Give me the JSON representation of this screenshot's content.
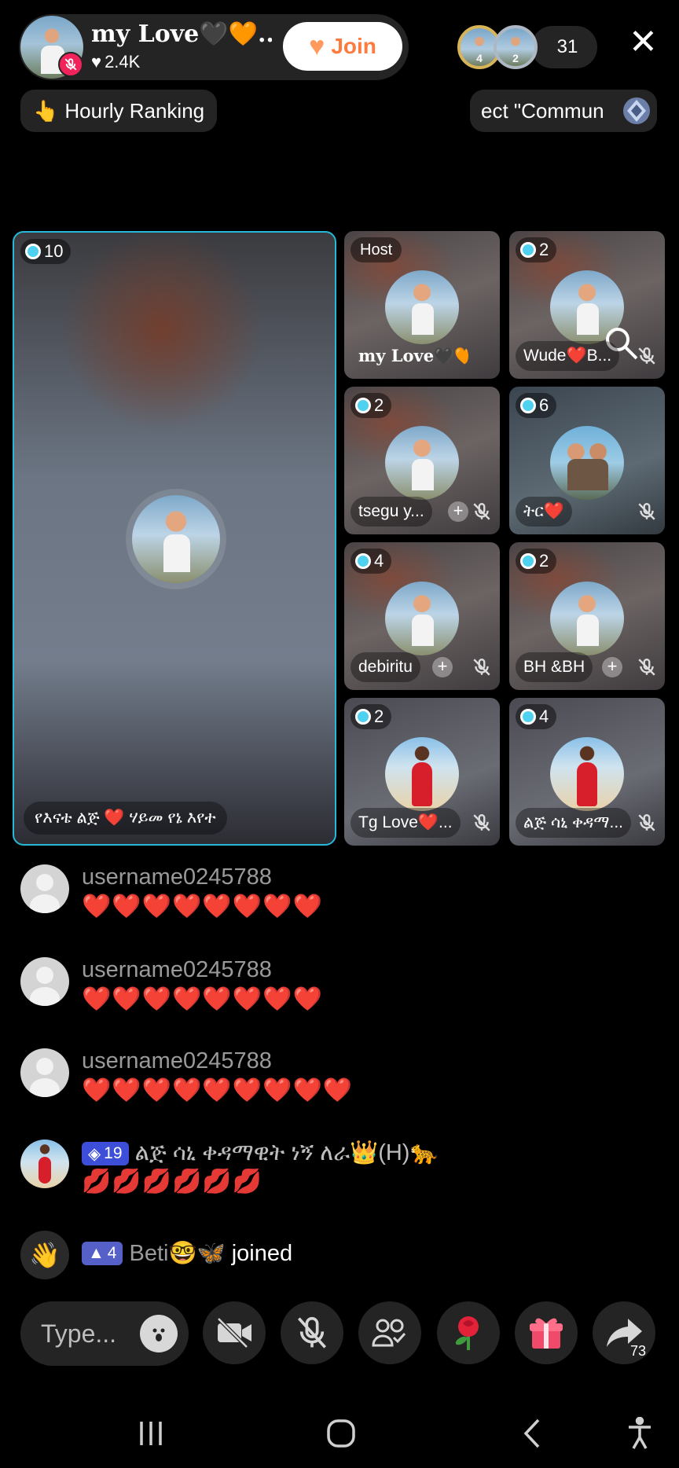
{
  "host": {
    "name": "my Love🖤🧡...",
    "likes": "2.4K",
    "join_label": "Join"
  },
  "viewers": {
    "top1_rank": "4",
    "top2_rank": "2",
    "count": "31"
  },
  "chips": {
    "hourly_ranking": "Hourly Ranking",
    "community": "ect \"Commun"
  },
  "main_seat": {
    "level": "10",
    "name": "የእናቴ ልጅ ❤️ ሃይመ የኔ እየተ"
  },
  "seats": [
    {
      "tag": "Host",
      "name": "my Love🖤🧡❤️"
    },
    {
      "level": "2",
      "name": "Wude❤️B..."
    },
    {
      "level": "2",
      "name": "tsegu  y..."
    },
    {
      "level": "6",
      "name": "ትር❤️"
    },
    {
      "level": "4",
      "name": "debiritu"
    },
    {
      "level": "2",
      "name": "BH  &BH"
    },
    {
      "level": "2",
      "name": "Tg Love❤️..."
    },
    {
      "level": "4",
      "name": "ልጅ ሳኒ ቀዳማ..."
    }
  ],
  "chat": [
    {
      "user": "username0245788",
      "message": "❤️❤️❤️❤️❤️❤️❤️❤️"
    },
    {
      "user": "username0245788",
      "message": "❤️❤️❤️❤️❤️❤️❤️❤️"
    },
    {
      "user": "username0245788",
      "message": "❤️❤️❤️❤️❤️❤️❤️❤️❤️"
    },
    {
      "level": "19",
      "user": "ልጅ ሳኒ ቀዳማዊት ነኝ ለራ👑(H)🐆",
      "message": "💋💋💋💋💋💋"
    },
    {
      "level": "4",
      "user": "Beti🤓🦋",
      "action": "joined"
    }
  ],
  "bottom": {
    "input_placeholder": "Type...",
    "share_count": "73"
  },
  "colors": {
    "accent_join": "#ff7a3d",
    "active_seat_border": "#25b8d8",
    "level_badge": "#3d4fd8",
    "pill_bg": "#242424"
  },
  "icons": [
    "heart-icon",
    "muted-mic-icon",
    "close-icon",
    "fire-hand-icon",
    "crystal-icon",
    "level-gem-icon",
    "mic-off-icon",
    "plus-icon",
    "magnifier-icon",
    "wave-hand-icon",
    "emoji-icon",
    "camera-off-icon",
    "mic-off-icon",
    "co-host-icon",
    "rose-icon",
    "gift-icon",
    "share-icon",
    "recents-icon",
    "home-icon",
    "back-icon",
    "accessibility-icon"
  ]
}
